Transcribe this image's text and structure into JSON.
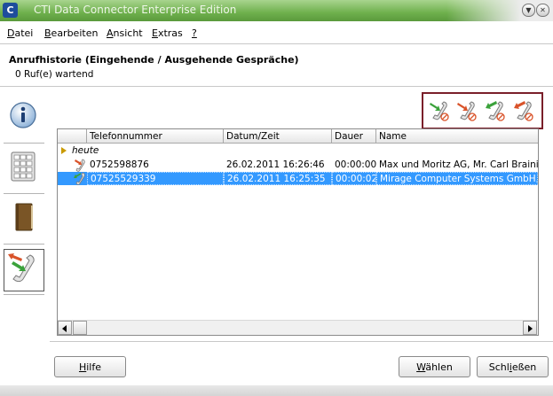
{
  "window": {
    "title": "CTI Data Connector Enterprise Edition"
  },
  "menu": {
    "items": [
      {
        "label": "Datei",
        "mnemonic": "D",
        "rest": "atei"
      },
      {
        "label": "Bearbeiten",
        "mnemonic": "B",
        "rest": "earbeiten"
      },
      {
        "label": "Ansicht",
        "mnemonic": "A",
        "rest": "nsicht"
      },
      {
        "label": "Extras",
        "mnemonic": "E",
        "rest": "xtras"
      },
      {
        "label": "?",
        "mnemonic": "?",
        "rest": ""
      }
    ]
  },
  "header": {
    "title": "Anrufhistorie (Eingehende / Ausgehende Gespräche)",
    "status": "0 Ruf(e) wartend"
  },
  "nav": {
    "items": [
      {
        "name": "info",
        "icon": "info-icon"
      },
      {
        "name": "dialpad",
        "icon": "keypad-icon"
      },
      {
        "name": "phonebook",
        "icon": "phonebook-icon"
      },
      {
        "name": "call-history",
        "icon": "call-history-icon",
        "active": true
      }
    ]
  },
  "filters": [
    {
      "icon": "incoming-answered-call-icon",
      "arrow_color": "#3ba23b"
    },
    {
      "icon": "incoming-missed-call-icon",
      "arrow_color": "#d9532a"
    },
    {
      "icon": "outgoing-answered-call-icon",
      "arrow_color": "#3ba23b"
    },
    {
      "icon": "outgoing-missed-call-icon",
      "arrow_color": "#d9532a"
    }
  ],
  "table": {
    "columns": [
      "Telefonnummer",
      "Datum/Zeit",
      "Dauer",
      "Name"
    ],
    "group_label": "heute",
    "rows": [
      {
        "number": "0752598876",
        "datetime": "26.02.2011 16:26:46",
        "duration": "00:00:00",
        "name": "Max und Moritz AG, Mr. Carl Brainie",
        "selected": false,
        "icon": "incoming-call-icon"
      },
      {
        "number": "07525529339",
        "datetime": "26.02.2011 16:25:35",
        "duration": "00:00:02",
        "name": "Mirage Computer Systems GmbH, Sale",
        "selected": true,
        "icon": "outgoing-call-icon"
      }
    ]
  },
  "buttons": {
    "help": {
      "mnemonic": "H",
      "rest": "ilfe"
    },
    "select": {
      "mnemonic": "W",
      "rest": "ählen"
    },
    "close": {
      "prefix": "Schl",
      "mnemonic": "i",
      "rest": "eßen"
    }
  },
  "colors": {
    "selection": "#3399ff",
    "filter_border": "#7a1f2a",
    "titlebar": "#6fb04d"
  }
}
